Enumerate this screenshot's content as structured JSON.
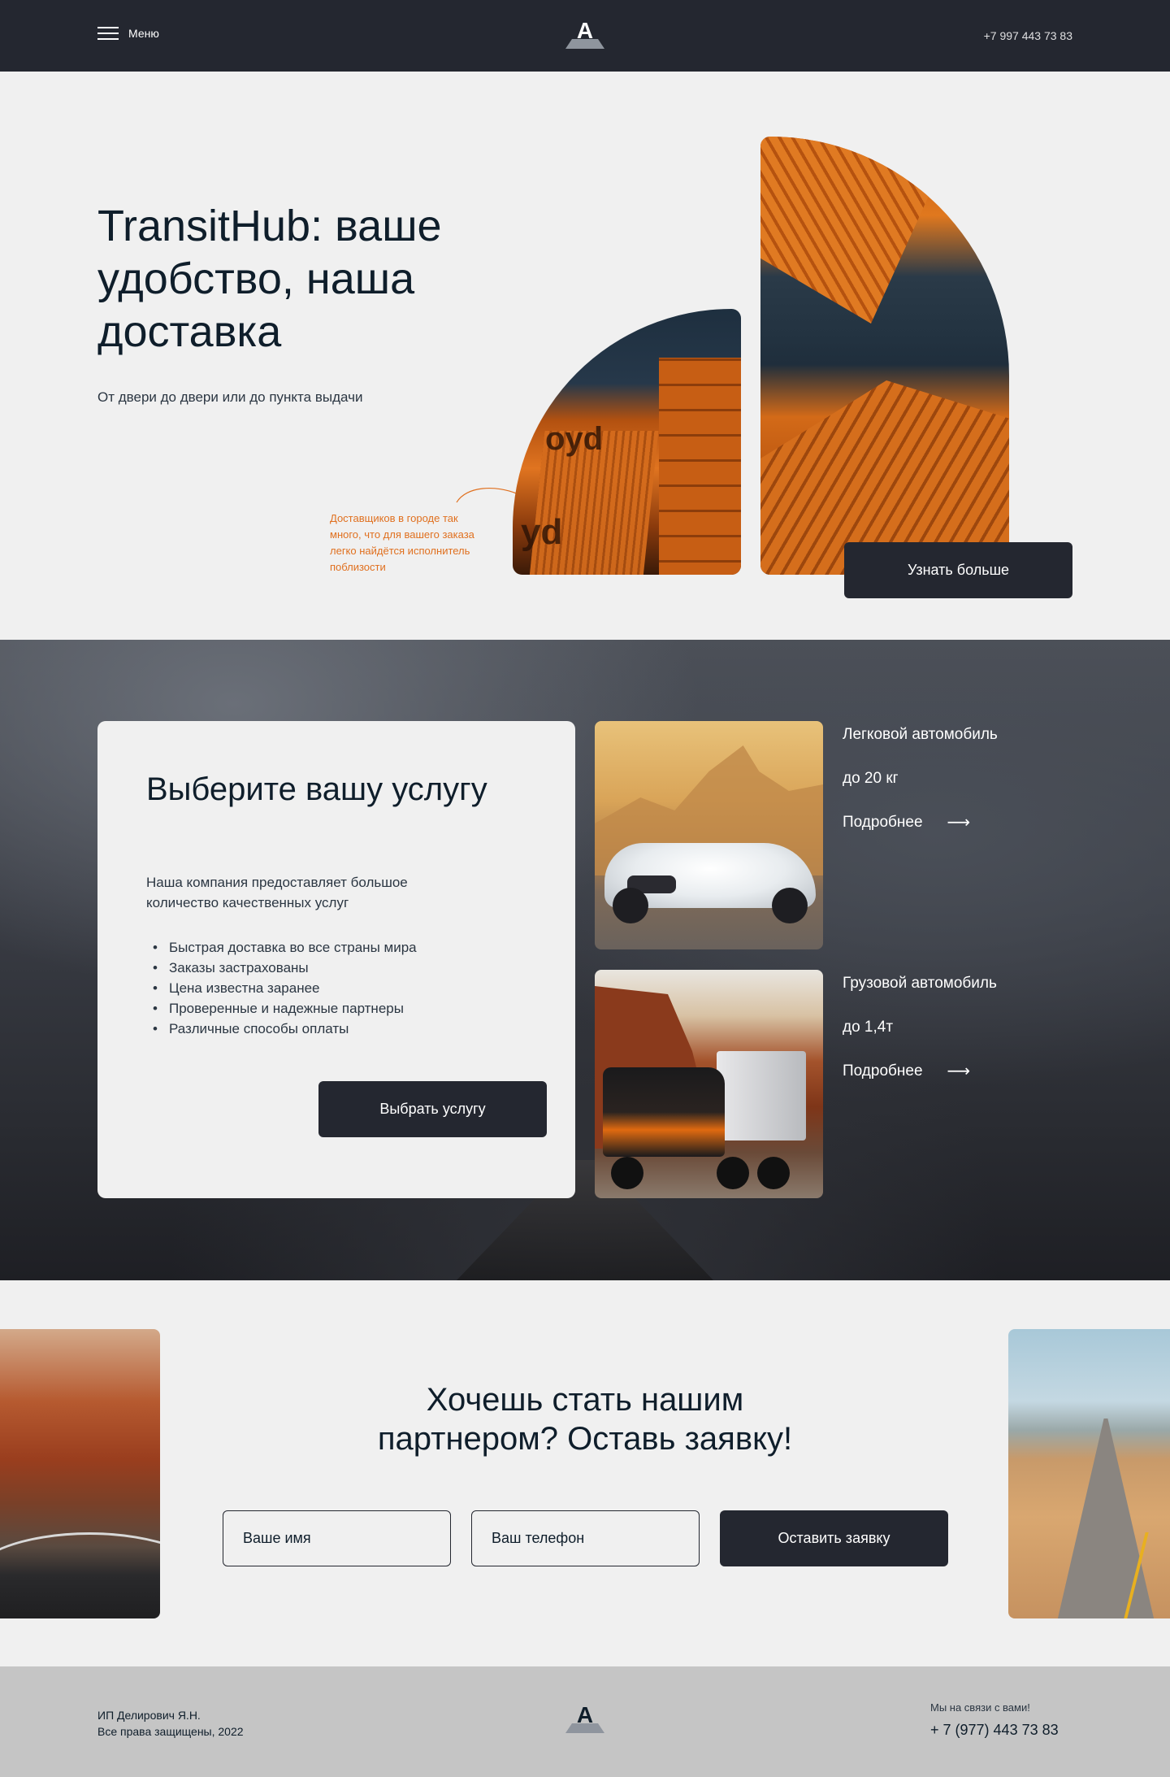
{
  "header": {
    "menu_label": "Меню",
    "logo_letter": "A",
    "phone": "+7 997 443 73 83"
  },
  "hero": {
    "title": "TransitHub: ваше удобство, наша доставка",
    "subtitle": "От двери до двери или до пункта выдачи",
    "note": "Доставщиков в городе так много, что для вашего заказа легко найдётся исполнитель поблизости",
    "learn_more_label": "Узнать больше"
  },
  "services": {
    "title": "Выберите вашу услугу",
    "description": "Наша компания предоставляет большое количество качественных услуг",
    "features": [
      "Быстрая доставка во все страны мира",
      "Заказы застрахованы",
      "Цена известна заранее",
      "Проверенные и надежные партнеры",
      "Различные способы оплаты"
    ],
    "choose_label": "Выбрать услугу",
    "options": [
      {
        "name": "Легковой автомобиль",
        "spec": "до 20 кг",
        "more": "Подробнее",
        "arrow": "⟶"
      },
      {
        "name": "Грузовой автомобиль",
        "spec": "до 1,4т",
        "more": "Подробнее",
        "arrow": "⟶"
      }
    ]
  },
  "partner": {
    "title": "Хочешь стать нашим партнером? Оставь заявку!",
    "name_placeholder": "Ваше имя",
    "phone_placeholder": "Ваш телефон",
    "submit_label": "Оставить заявку"
  },
  "footer": {
    "owner": "ИП Делирович Я.Н.",
    "rights": "Все права защищены, 2022",
    "logo_letter": "A",
    "contact_caption": "Мы на связи с вами!",
    "phone": "+ 7 (977) 443 73 83"
  },
  "colors": {
    "dark": "#242730",
    "accent": "#e0701f",
    "background": "#f0f0f0",
    "footer_bg": "#c5c5c5"
  }
}
